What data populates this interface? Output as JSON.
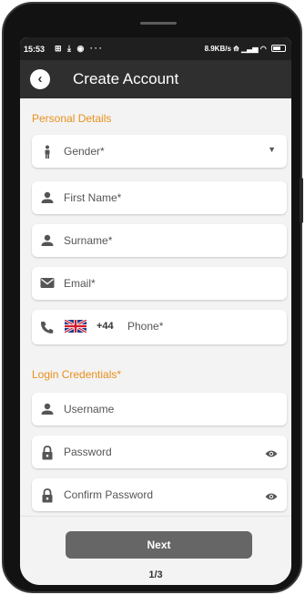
{
  "status_bar": {
    "time": "15:53",
    "notif_icons": "⊞ ⤓ ◉ ···",
    "net_speed": "8.9KB/s"
  },
  "app_bar": {
    "title": "Create Account",
    "back_icon": "chevron-left-icon"
  },
  "personal": {
    "title": "Personal Details",
    "gender": "Gender*",
    "first_name": "First Name*",
    "surname": "Surname*",
    "email": "Email*",
    "phone_code": "+44",
    "phone": "Phone*"
  },
  "login": {
    "title": "Login Credentials*",
    "username": "Username",
    "password": "Password",
    "confirm_password": "Confirm Password"
  },
  "footer": {
    "next_label": "Next",
    "page_indicator": "1/3"
  },
  "colors": {
    "accent": "#e8901c",
    "app_bar": "#2f2f2f",
    "button": "#666666",
    "background": "#f3f3f3"
  }
}
